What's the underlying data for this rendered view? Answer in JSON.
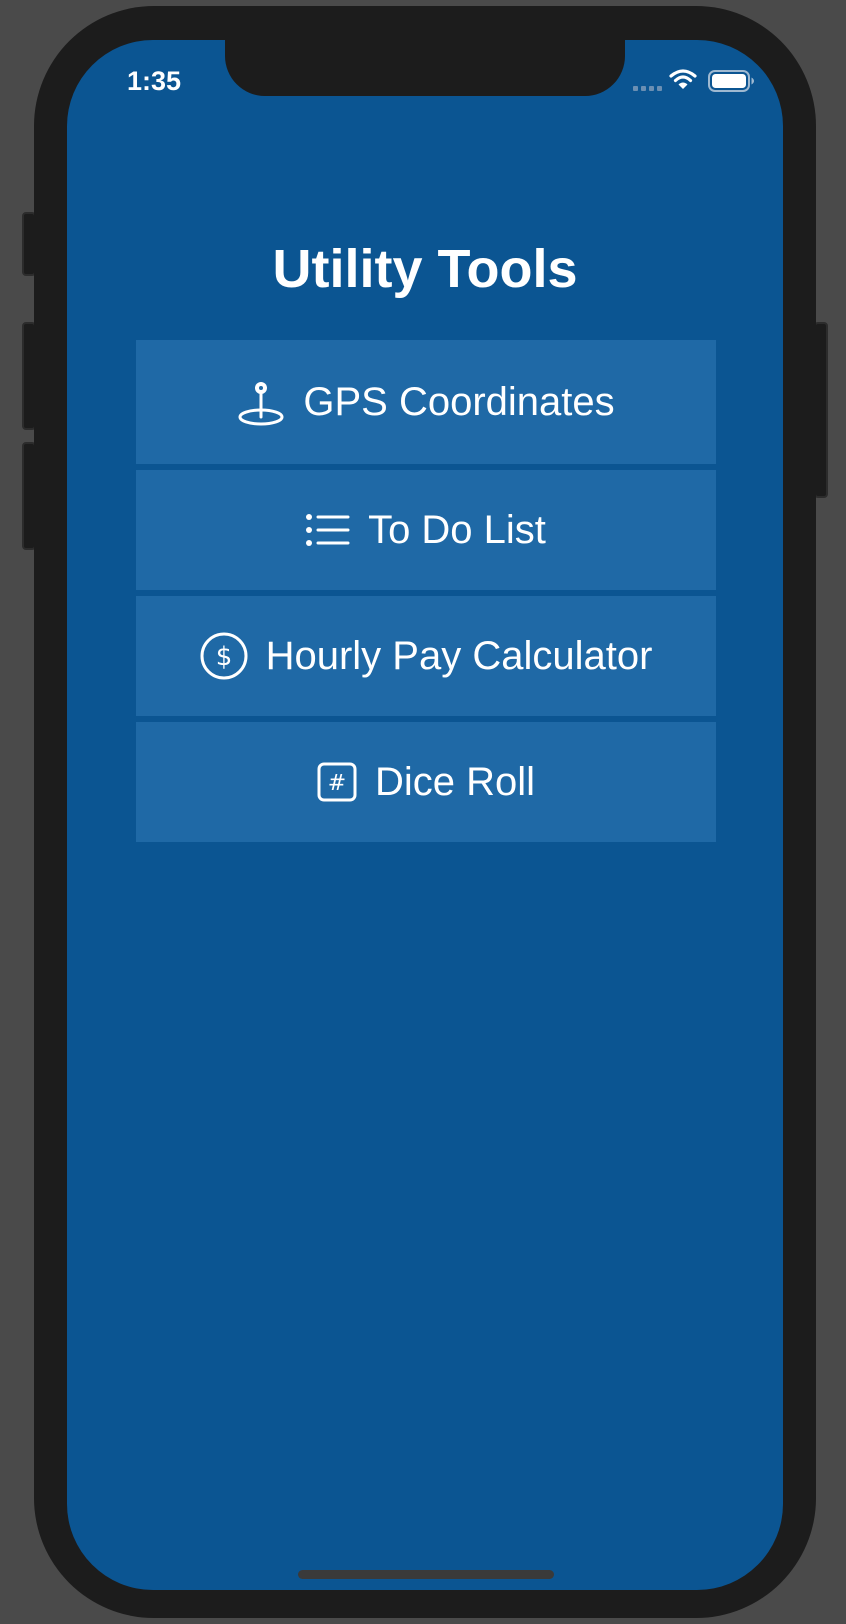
{
  "status_bar": {
    "time": "1:35",
    "icons": [
      "cellular-signal-icon",
      "wifi-icon",
      "battery-icon"
    ]
  },
  "header": {
    "title": "Utility Tools"
  },
  "menu": {
    "items": [
      {
        "label": "GPS Coordinates",
        "icon": "map-pin-icon"
      },
      {
        "label": "To Do List",
        "icon": "list-icon"
      },
      {
        "label": "Hourly Pay Calculator",
        "icon": "dollar-circle-icon"
      },
      {
        "label": "Dice Roll",
        "icon": "hash-square-icon"
      }
    ]
  },
  "colors": {
    "background": "#0b5592",
    "button": "#1f69a6",
    "text": "#ffffff",
    "device_frame": "#1c1c1c"
  }
}
